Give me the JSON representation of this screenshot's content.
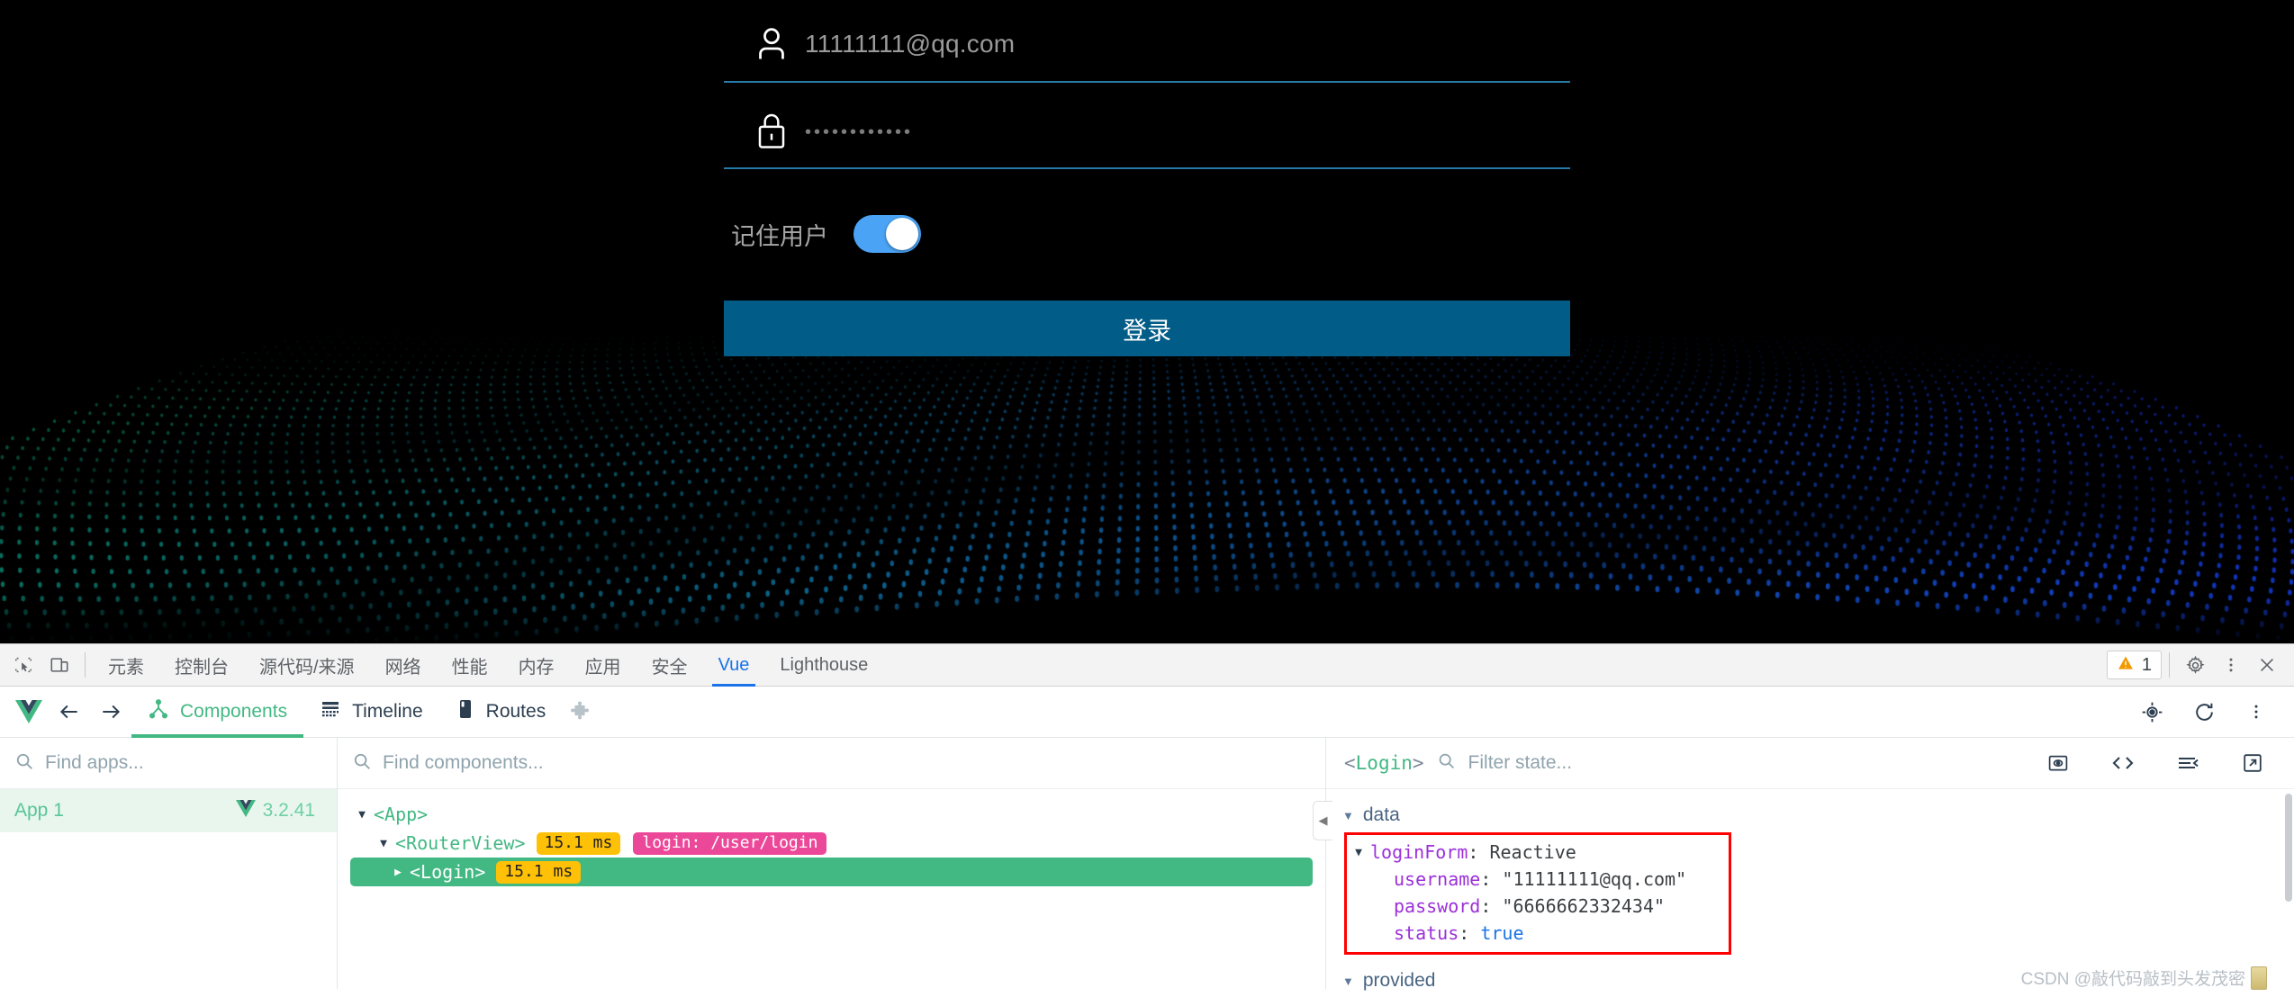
{
  "page": {
    "login": {
      "username_icon": "person-icon",
      "username_value": "11111111@qq.com",
      "password_icon": "lock-icon",
      "password_value": "••••••••••••",
      "remember_label": "记住用户",
      "remember_on": true,
      "submit_label": "登录",
      "accent_color": "#015c87",
      "toggle_color": "#4aa3f5",
      "underline_color": "#2878a8"
    }
  },
  "devtools": {
    "tabs": [
      {
        "label": "元素",
        "active": false
      },
      {
        "label": "控制台",
        "active": false
      },
      {
        "label": "源代码/来源",
        "active": false
      },
      {
        "label": "网络",
        "active": false
      },
      {
        "label": "性能",
        "active": false
      },
      {
        "label": "内存",
        "active": false
      },
      {
        "label": "应用",
        "active": false
      },
      {
        "label": "安全",
        "active": false
      },
      {
        "label": "Vue",
        "active": true
      },
      {
        "label": "Lighthouse",
        "active": false
      }
    ],
    "left_icons": [
      "inspect-element-icon",
      "device-toolbar-icon"
    ],
    "warnings_count": "1",
    "right_icons": [
      "warning-icon",
      "settings-gear-icon",
      "more-options-icon",
      "close-icon"
    ],
    "active_tab_color": "#1a73e8"
  },
  "vue": {
    "brand_color": "#42b883",
    "logo": "vue-logo-icon",
    "nav": {
      "back": "←",
      "forward": "→"
    },
    "tabs": [
      {
        "label": "Components",
        "icon": "components-tree-icon",
        "active": true
      },
      {
        "label": "Timeline",
        "icon": "timeline-icon",
        "active": false
      },
      {
        "label": "Routes",
        "icon": "routes-icon",
        "active": false
      }
    ],
    "plugin_icon": "puzzle-piece-icon",
    "toolbar_right_icons": [
      "select-component-icon",
      "refresh-icon",
      "more-options-icon"
    ],
    "apps_pane": {
      "search_placeholder": "Find apps...",
      "search_icon": "search-icon",
      "items": [
        {
          "name": "App 1",
          "version": "3.2.41",
          "selected": true
        }
      ]
    },
    "tree_pane": {
      "search_placeholder": "Find components...",
      "search_icon": "search-icon",
      "nodes": [
        {
          "depth": 0,
          "caret": "▼",
          "tag": "<App>",
          "time": "",
          "route": "",
          "selected": false
        },
        {
          "depth": 1,
          "caret": "▼",
          "tag": "<RouterView>",
          "time": "15.1 ms",
          "route": "login: /user/login",
          "selected": false
        },
        {
          "depth": 2,
          "caret": "▶",
          "tag": "<Login>",
          "time": "15.1 ms",
          "route": "",
          "selected": true
        }
      ]
    },
    "state_pane": {
      "component": "<Login>",
      "filter_placeholder": "Filter state...",
      "filter_icon": "search-icon",
      "header_icons": [
        "inspect-dom-icon",
        "open-in-editor-code-icon",
        "collapse-all-icon",
        "open-external-icon"
      ],
      "groups": [
        {
          "name": "data",
          "caret": "▼",
          "highlighted": true,
          "rows": [
            {
              "caret": "▼",
              "indent": 0,
              "key": "loginForm",
              "value": "Reactive",
              "type": "type"
            },
            {
              "caret": "",
              "indent": 1,
              "key": "username",
              "value": "\"11111111@qq.com\"",
              "type": "string"
            },
            {
              "caret": "",
              "indent": 1,
              "key": "password",
              "value": "\"6666662332434\"",
              "type": "string"
            },
            {
              "caret": "",
              "indent": 1,
              "key": "status",
              "value": "true",
              "type": "boolean"
            }
          ]
        },
        {
          "name": "provided",
          "caret": "▼",
          "highlighted": false,
          "rows": []
        }
      ],
      "highlight_border_color": "#ff0000"
    }
  },
  "watermark": {
    "text": "CSDN @敲代码敲到头发茂密"
  }
}
